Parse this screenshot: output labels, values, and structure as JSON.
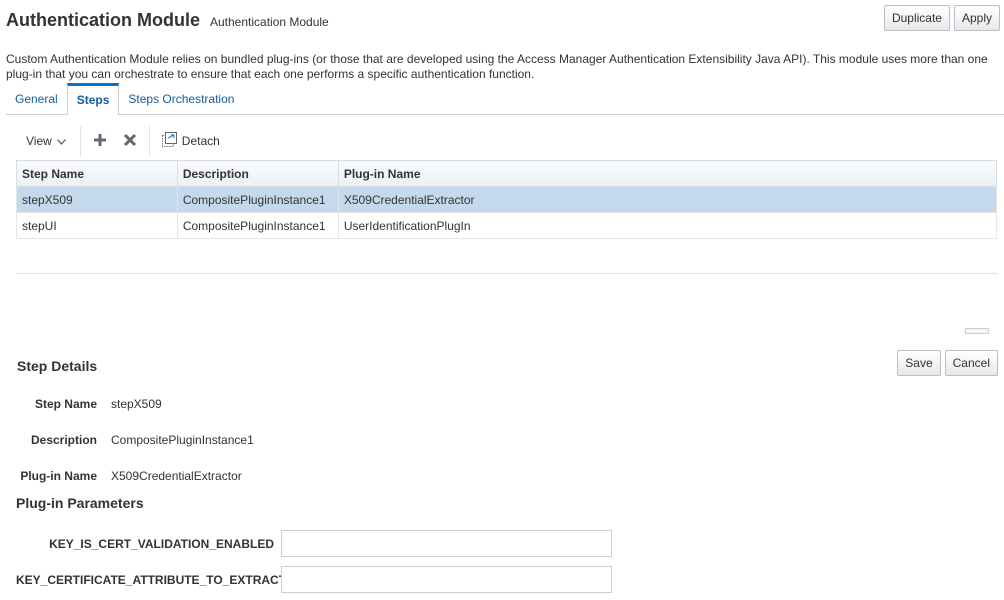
{
  "header": {
    "title": "Authentication Module",
    "subtitle": "Authentication Module",
    "duplicate_label": "Duplicate",
    "apply_label": "Apply"
  },
  "description": "Custom Authentication Module relies on bundled plug-ins (or those that are developed using the Access Manager Authentication Extensibility Java API). This module uses more than one plug-in that you can orchestrate to ensure that each one performs a specific authentication function.",
  "tabs": [
    {
      "label": "General",
      "active": false
    },
    {
      "label": "Steps",
      "active": true
    },
    {
      "label": "Steps Orchestration",
      "active": false
    }
  ],
  "toolbar": {
    "view_label": "View",
    "add_icon": "plus-icon",
    "delete_icon": "x-icon",
    "detach_label": "Detach"
  },
  "table": {
    "columns": [
      "Step Name",
      "Description",
      "Plug-in Name"
    ],
    "rows": [
      {
        "step": "stepX509",
        "description": "CompositePluginInstance1",
        "plugin": "X509CredentialExtractor",
        "selected": true
      },
      {
        "step": "stepUI",
        "description": "CompositePluginInstance1",
        "plugin": "UserIdentificationPlugIn",
        "selected": false
      }
    ]
  },
  "step_details": {
    "title": "Step Details",
    "save_label": "Save",
    "cancel_label": "Cancel",
    "step_name_label": "Step Name",
    "step_name_value": "stepX509",
    "description_label": "Description",
    "description_value": "CompositePluginInstance1",
    "plugin_name_label": "Plug-in Name",
    "plugin_name_value": "X509CredentialExtractor"
  },
  "plugin_params": {
    "title": "Plug-in Parameters",
    "params": [
      {
        "label": "KEY_IS_CERT_VALIDATION_ENABLED",
        "value": ""
      },
      {
        "label": "KEY_CERTIFICATE_ATTRIBUTE_TO_EXTRACT",
        "value": ""
      }
    ]
  },
  "colors": {
    "accent": "#0572ce",
    "link": "#145c9e",
    "selected_row": "#c4d9ec"
  }
}
